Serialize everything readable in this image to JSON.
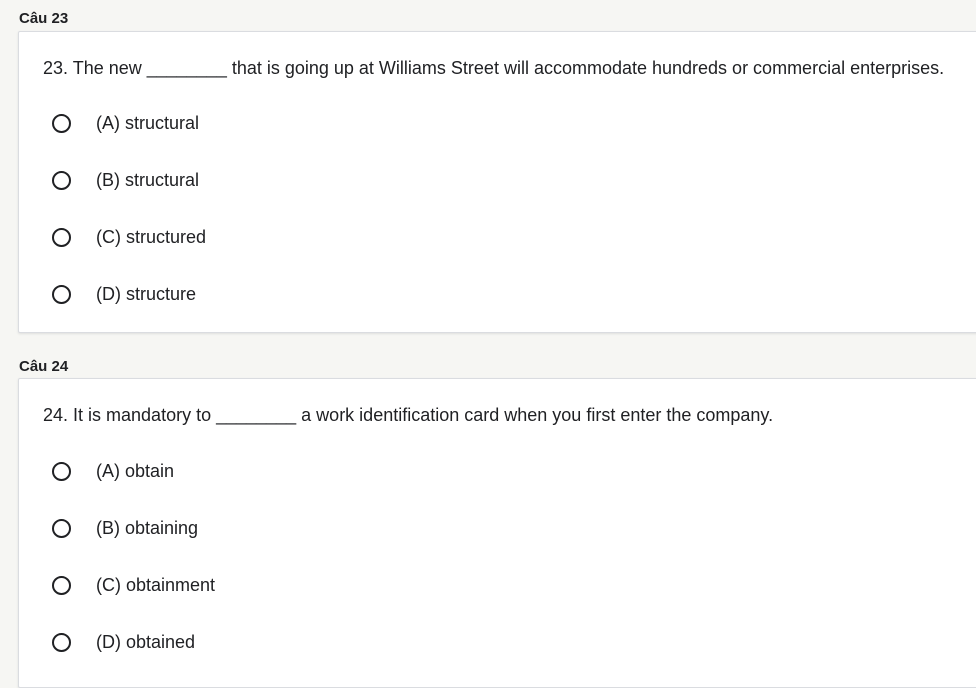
{
  "questions": [
    {
      "section_label": "Câu 23",
      "text": "23. The new ________ that is going up at Williams Street will accommodate hundreds or commercial enterprises.",
      "options": [
        "(A) structural",
        "(B) structural",
        "(C) structured",
        "(D) structure"
      ]
    },
    {
      "section_label": "Câu 24",
      "text": "24. It is mandatory to ________ a work identification card when you first enter the company.",
      "options": [
        "(A) obtain",
        "(B) obtaining",
        "(C) obtainment",
        "(D) obtained"
      ]
    }
  ]
}
